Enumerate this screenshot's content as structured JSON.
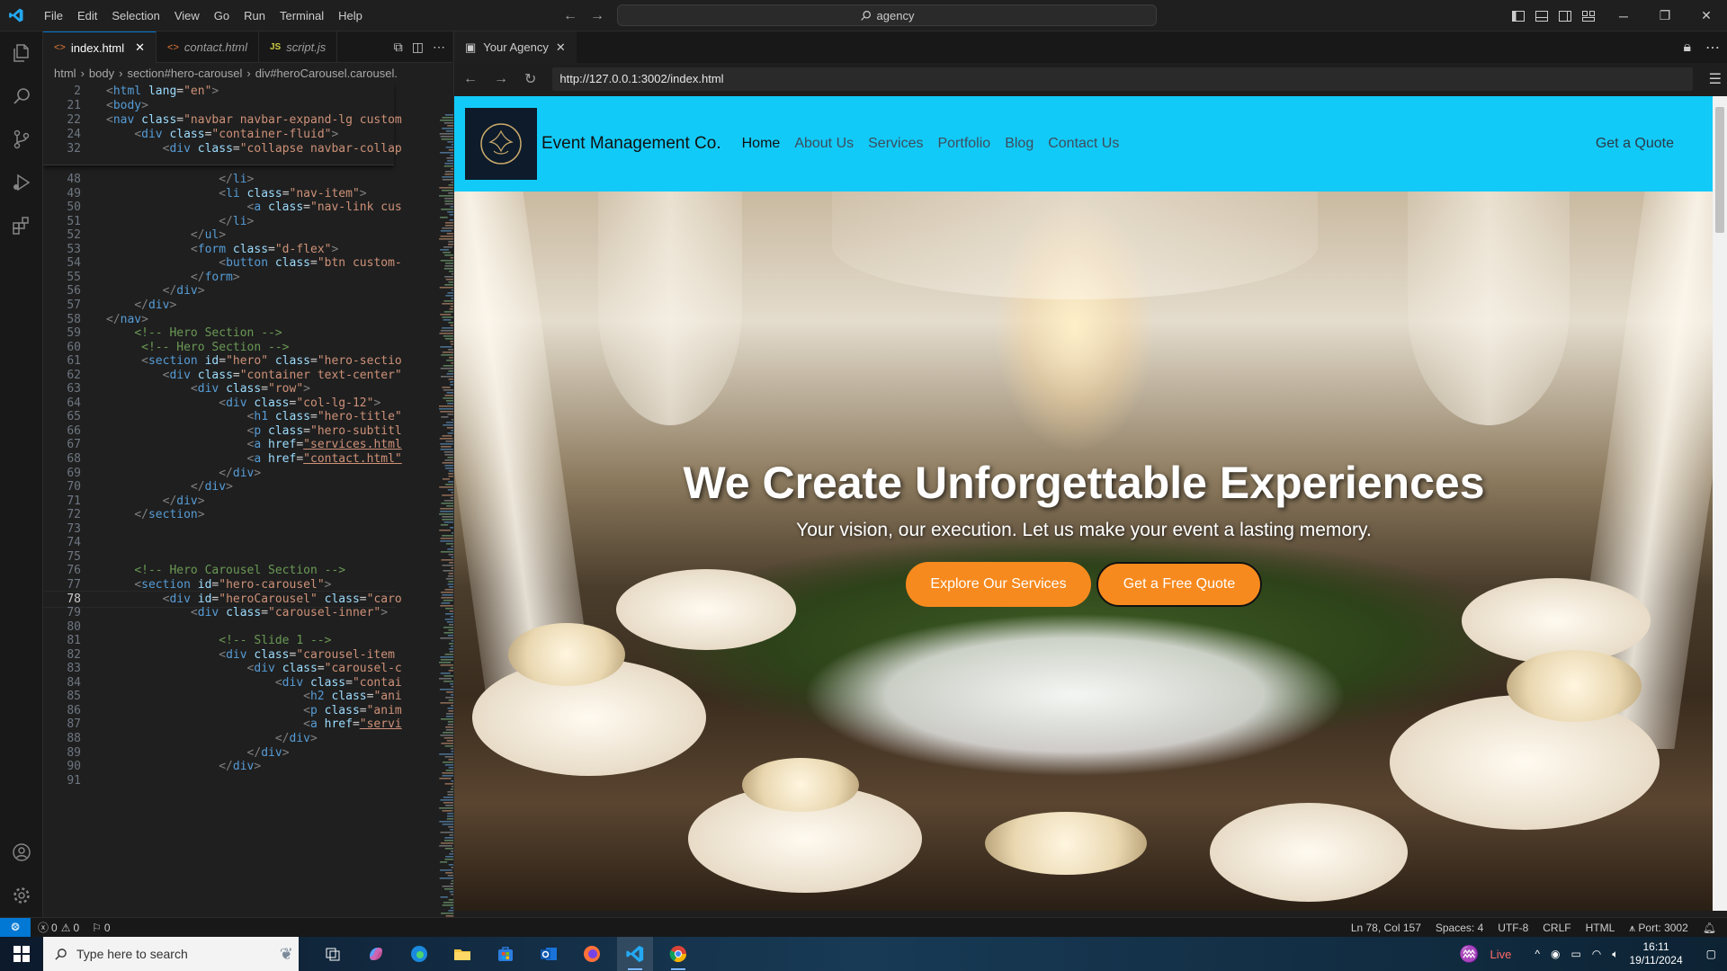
{
  "titlebar": {
    "menus": [
      "File",
      "Edit",
      "Selection",
      "View",
      "Go",
      "Run",
      "Terminal",
      "Help"
    ],
    "search_text": "agency"
  },
  "editor": {
    "tabs": [
      {
        "label": "index.html",
        "active": true
      },
      {
        "label": "contact.html",
        "active": false
      },
      {
        "label": "script.js",
        "active": false
      }
    ],
    "breadcrumb": [
      "html",
      "body",
      "section#hero-carousel",
      "div#heroCarousel.carousel."
    ],
    "sticky_lines": [
      {
        "n": "2",
        "html": "<span class=\"br\">&lt;</span><span class=\"tg\">html</span> <span class=\"at\">lang</span>=<span class=\"st\">\"en\"</span><span class=\"br\">&gt;</span>"
      },
      {
        "n": "21",
        "html": "<span class=\"br\">&lt;</span><span class=\"tg\">body</span><span class=\"br\">&gt;</span>"
      },
      {
        "n": "22",
        "html": "<span class=\"br\">&lt;</span><span class=\"tg\">nav</span> <span class=\"at\">class</span>=<span class=\"st\">\"navbar navbar-expand-lg custom</span>"
      },
      {
        "n": "24",
        "html": "    <span class=\"br\">&lt;</span><span class=\"tg\">div</span> <span class=\"at\">class</span>=<span class=\"st\">\"container-fluid\"</span><span class=\"br\">&gt;</span>"
      },
      {
        "n": "32",
        "html": "        <span class=\"br\">&lt;</span><span class=\"tg\">div</span> <span class=\"at\">class</span>=<span class=\"st\">\"collapse navbar-collap</span>"
      }
    ],
    "lines": [
      {
        "n": "48",
        "html": "                <span class=\"br\">&lt;/</span><span class=\"tg\">li</span><span class=\"br\">&gt;</span>"
      },
      {
        "n": "49",
        "html": "                <span class=\"br\">&lt;</span><span class=\"tg\">li</span> <span class=\"at\">class</span>=<span class=\"st\">\"nav-item\"</span><span class=\"br\">&gt;</span>"
      },
      {
        "n": "50",
        "html": "                    <span class=\"br\">&lt;</span><span class=\"tg\">a</span> <span class=\"at\">class</span>=<span class=\"st\">\"nav-link cus</span>"
      },
      {
        "n": "51",
        "html": "                <span class=\"br\">&lt;/</span><span class=\"tg\">li</span><span class=\"br\">&gt;</span>"
      },
      {
        "n": "52",
        "html": "            <span class=\"br\">&lt;/</span><span class=\"tg\">ul</span><span class=\"br\">&gt;</span>"
      },
      {
        "n": "53",
        "html": "            <span class=\"br\">&lt;</span><span class=\"tg\">form</span> <span class=\"at\">class</span>=<span class=\"st\">\"d-flex\"</span><span class=\"br\">&gt;</span>"
      },
      {
        "n": "54",
        "html": "                <span class=\"br\">&lt;</span><span class=\"tg\">button</span> <span class=\"at\">class</span>=<span class=\"st\">\"btn custom-</span>"
      },
      {
        "n": "55",
        "html": "            <span class=\"br\">&lt;/</span><span class=\"tg\">form</span><span class=\"br\">&gt;</span>"
      },
      {
        "n": "56",
        "html": "        <span class=\"br\">&lt;/</span><span class=\"tg\">div</span><span class=\"br\">&gt;</span>"
      },
      {
        "n": "57",
        "html": "    <span class=\"br\">&lt;/</span><span class=\"tg\">div</span><span class=\"br\">&gt;</span>"
      },
      {
        "n": "58",
        "html": "<span class=\"br\">&lt;/</span><span class=\"tg\">nav</span><span class=\"br\">&gt;</span>"
      },
      {
        "n": "59",
        "html": "    <span class=\"cm\">&lt;!-- Hero Section --&gt;</span>"
      },
      {
        "n": "60",
        "html": "     <span class=\"cm\">&lt;!-- Hero Section --&gt;</span>"
      },
      {
        "n": "61",
        "html": "     <span class=\"br\">&lt;</span><span class=\"tg\">section</span> <span class=\"at\">id</span>=<span class=\"st\">\"hero\"</span> <span class=\"at\">class</span>=<span class=\"st\">\"hero-sectio</span>"
      },
      {
        "n": "62",
        "html": "        <span class=\"br\">&lt;</span><span class=\"tg\">div</span> <span class=\"at\">class</span>=<span class=\"st\">\"container text-center\"</span>"
      },
      {
        "n": "63",
        "html": "            <span class=\"br\">&lt;</span><span class=\"tg\">div</span> <span class=\"at\">class</span>=<span class=\"st\">\"row\"</span><span class=\"br\">&gt;</span>"
      },
      {
        "n": "64",
        "html": "                <span class=\"br\">&lt;</span><span class=\"tg\">div</span> <span class=\"at\">class</span>=<span class=\"st\">\"col-lg-12\"</span><span class=\"br\">&gt;</span>"
      },
      {
        "n": "65",
        "html": "                    <span class=\"br\">&lt;</span><span class=\"tg\">h1</span> <span class=\"at\">class</span>=<span class=\"st\">\"hero-title\"</span>"
      },
      {
        "n": "66",
        "html": "                    <span class=\"br\">&lt;</span><span class=\"tg\">p</span> <span class=\"at\">class</span>=<span class=\"st\">\"hero-subtitl</span>"
      },
      {
        "n": "67",
        "html": "                    <span class=\"br\">&lt;</span><span class=\"tg\">a</span> <span class=\"at\">href</span>=<span class=\"st\" style=\"text-decoration:underline\">\"services.html</span>"
      },
      {
        "n": "68",
        "html": "                    <span class=\"br\">&lt;</span><span class=\"tg\">a</span> <span class=\"at\">href</span>=<span class=\"st\" style=\"text-decoration:underline\">\"contact.html\"</span>"
      },
      {
        "n": "69",
        "html": "                <span class=\"br\">&lt;/</span><span class=\"tg\">div</span><span class=\"br\">&gt;</span>"
      },
      {
        "n": "70",
        "html": "            <span class=\"br\">&lt;/</span><span class=\"tg\">div</span><span class=\"br\">&gt;</span>"
      },
      {
        "n": "71",
        "html": "        <span class=\"br\">&lt;/</span><span class=\"tg\">div</span><span class=\"br\">&gt;</span>"
      },
      {
        "n": "72",
        "html": "    <span class=\"br\">&lt;/</span><span class=\"tg\">section</span><span class=\"br\">&gt;</span>"
      },
      {
        "n": "73",
        "html": ""
      },
      {
        "n": "74",
        "html": ""
      },
      {
        "n": "75",
        "html": ""
      },
      {
        "n": "76",
        "html": "    <span class=\"cm\">&lt;!-- Hero Carousel Section --&gt;</span>"
      },
      {
        "n": "77",
        "html": "    <span class=\"br\">&lt;</span><span class=\"tg\">section</span> <span class=\"at\">id</span>=<span class=\"st\">\"hero-carousel\"</span><span class=\"br\">&gt;</span>"
      },
      {
        "n": "78",
        "html": "        <span class=\"br\">&lt;</span><span class=\"tg\">div</span> <span class=\"at\">id</span>=<span class=\"st\">\"heroCarousel\"</span> <span class=\"at\">class</span>=<span class=\"st\">\"caro</span>"
      },
      {
        "n": "79",
        "html": "            <span class=\"br\">&lt;</span><span class=\"tg\">div</span> <span class=\"at\">class</span>=<span class=\"st\">\"carousel-inner\"</span><span class=\"br\">&gt;</span>"
      },
      {
        "n": "80",
        "html": ""
      },
      {
        "n": "81",
        "html": "                <span class=\"cm\">&lt;!-- Slide 1 --&gt;</span>"
      },
      {
        "n": "82",
        "html": "                <span class=\"br\">&lt;</span><span class=\"tg\">div</span> <span class=\"at\">class</span>=<span class=\"st\">\"carousel-item</span>"
      },
      {
        "n": "83",
        "html": "                    <span class=\"br\">&lt;</span><span class=\"tg\">div</span> <span class=\"at\">class</span>=<span class=\"st\">\"carousel-c</span>"
      },
      {
        "n": "84",
        "html": "                        <span class=\"br\">&lt;</span><span class=\"tg\">div</span> <span class=\"at\">class</span>=<span class=\"st\">\"contai</span>"
      },
      {
        "n": "85",
        "html": "                            <span class=\"br\">&lt;</span><span class=\"tg\">h2</span> <span class=\"at\">class</span>=<span class=\"st\">\"ani</span>"
      },
      {
        "n": "86",
        "html": "                            <span class=\"br\">&lt;</span><span class=\"tg\">p</span> <span class=\"at\">class</span>=<span class=\"st\">\"anim</span>"
      },
      {
        "n": "87",
        "html": "                            <span class=\"br\">&lt;</span><span class=\"tg\">a</span> <span class=\"at\">href</span>=<span class=\"st\" style=\"text-decoration:underline\">\"servi</span>"
      },
      {
        "n": "88",
        "html": "                        <span class=\"br\">&lt;/</span><span class=\"tg\">div</span><span class=\"br\">&gt;</span>"
      },
      {
        "n": "89",
        "html": "                    <span class=\"br\">&lt;/</span><span class=\"tg\">div</span><span class=\"br\">&gt;</span>"
      },
      {
        "n": "90",
        "html": "                <span class=\"br\">&lt;/</span><span class=\"tg\">div</span><span class=\"br\">&gt;</span>"
      },
      {
        "n": "91",
        "html": ""
      }
    ],
    "current_line": "78"
  },
  "browser": {
    "tab_title": "Your Agency",
    "url": "http://127.0.0.1:3002/index.html"
  },
  "site": {
    "brand": "Event Management Co.",
    "nav": [
      "Home",
      "About Us",
      "Services",
      "Portfolio",
      "Blog",
      "Contact Us"
    ],
    "quote_link": "Get a Quote",
    "hero_title": "We Create Unforgettable Experiences",
    "hero_subtitle": "Your vision, our execution. Let us make your event a lasting memory.",
    "btn_explore": "Explore Our Services",
    "btn_quote": "Get a Free Quote",
    "accent": "#12caf8",
    "button_color": "#f78a1e"
  },
  "statusbar": {
    "errors": "0",
    "warnings": "0",
    "ports": "0",
    "position": "Ln 78, Col 157",
    "spaces": "Spaces: 4",
    "encoding": "UTF-8",
    "eol": "CRLF",
    "language": "HTML",
    "port": "Port: 3002"
  },
  "taskbar": {
    "search_placeholder": "Type here to search",
    "weather": "Live",
    "time": "16:11",
    "date": "19/11/2024"
  }
}
